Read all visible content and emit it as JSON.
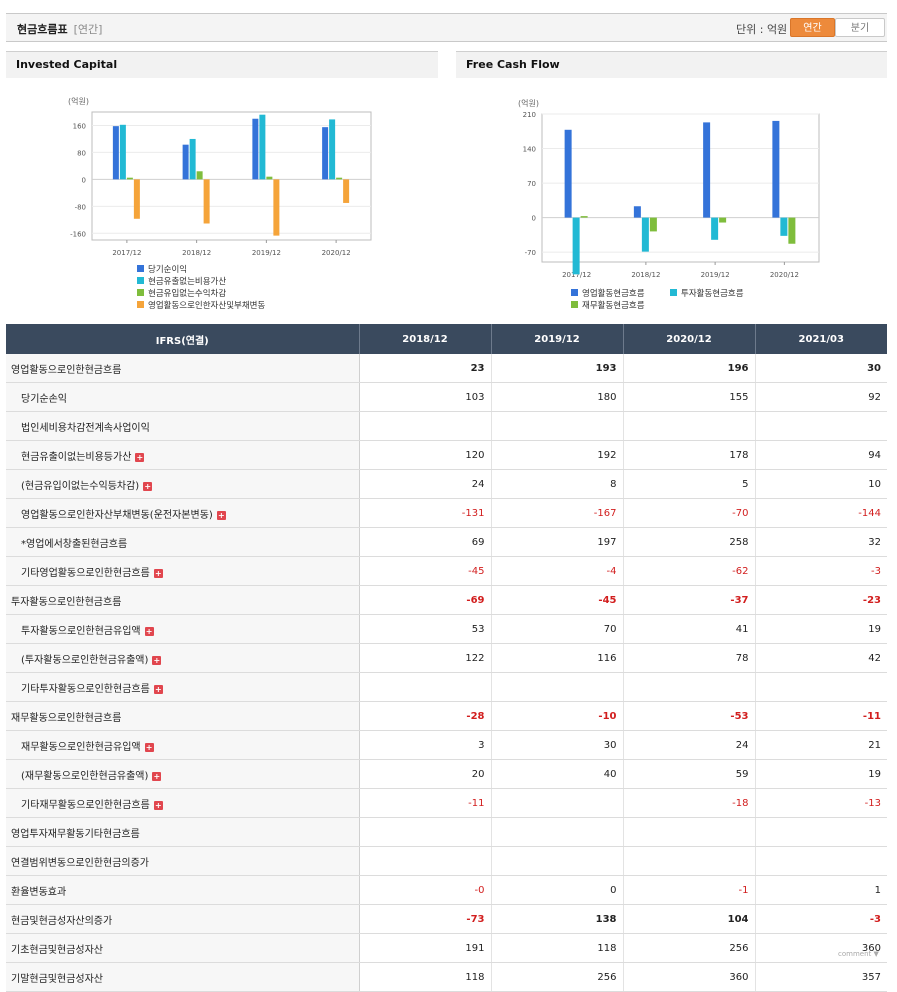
{
  "header": {
    "title": "현금흐름표",
    "subtitle": "[연간]",
    "unit_label": "단위 : 억원",
    "annual_button": "연간",
    "quarter_button": "분기"
  },
  "panels": {
    "invested_capital_title": "Invested Capital",
    "fcf_title": "Free Cash Flow"
  },
  "chart_data": [
    {
      "type": "bar",
      "ylabel": "(억원)",
      "categories": [
        "2017/12",
        "2018/12",
        "2019/12",
        "2020/12"
      ],
      "ylim": [
        -180,
        200
      ],
      "yticks": [
        160,
        80,
        0,
        -80,
        -160
      ],
      "series": [
        {
          "name": "당기순이익",
          "color": "#3473d9",
          "values": [
            158,
            103,
            180,
            155
          ]
        },
        {
          "name": "현금유출없는비용가산",
          "color": "#22b9d4",
          "values": [
            162,
            120,
            192,
            178
          ]
        },
        {
          "name": "현금유입없는수익차감",
          "color": "#7fbd3c",
          "values": [
            5,
            24,
            8,
            5
          ]
        },
        {
          "name": "영업활동으로인한자산및부채변동",
          "color": "#f5a43a",
          "values": [
            -117,
            -131,
            -167,
            -70
          ]
        }
      ],
      "legend": "bottom-left",
      "grid": true
    },
    {
      "type": "bar",
      "ylabel": "(억원)",
      "categories": [
        "2017/12",
        "2018/12",
        "2019/12",
        "2020/12"
      ],
      "ylim": [
        -90,
        210
      ],
      "yticks": [
        210,
        140,
        70,
        0,
        -70
      ],
      "series": [
        {
          "name": "영업활동현금흐름",
          "color": "#3473d9",
          "values": [
            178,
            23,
            193,
            196
          ]
        },
        {
          "name": "투자활동현금흐름",
          "color": "#22b9d4",
          "values": [
            -115,
            -69,
            -45,
            -37
          ]
        },
        {
          "name": "재무활동현금흐름",
          "color": "#7fbd3c",
          "values": [
            3,
            -28,
            -10,
            -53
          ]
        }
      ],
      "legend": "bottom-center",
      "grid": true
    }
  ],
  "table": {
    "header_label": "IFRS(연결)",
    "columns": [
      "2018/12",
      "2019/12",
      "2020/12",
      "2021/03"
    ],
    "rows": [
      {
        "label": "영업활동으로인한현금흐름",
        "indent": false,
        "bold": true,
        "plus": false,
        "values": [
          "23",
          "193",
          "196",
          "30"
        ]
      },
      {
        "label": "당기순손익",
        "indent": true,
        "bold": false,
        "plus": false,
        "values": [
          "103",
          "180",
          "155",
          "92"
        ]
      },
      {
        "label": "법인세비용차감전계속사업이익",
        "indent": true,
        "bold": false,
        "plus": false,
        "values": [
          "",
          "",
          "",
          ""
        ]
      },
      {
        "label": "현금유출이없는비용등가산",
        "indent": true,
        "bold": false,
        "plus": true,
        "values": [
          "120",
          "192",
          "178",
          "94"
        ]
      },
      {
        "label": "(현금유입이없는수익등차감)",
        "indent": true,
        "bold": false,
        "plus": true,
        "values": [
          "24",
          "8",
          "5",
          "10"
        ]
      },
      {
        "label": "영업활동으로인한자산부채변동(운전자본변동)",
        "indent": true,
        "bold": false,
        "plus": true,
        "values": [
          "-131",
          "-167",
          "-70",
          "-144"
        ]
      },
      {
        "label": "*영업에서창출된현금흐름",
        "indent": true,
        "bold": false,
        "plus": false,
        "values": [
          "69",
          "197",
          "258",
          "32"
        ]
      },
      {
        "label": "기타영업활동으로인한현금흐름",
        "indent": true,
        "bold": false,
        "plus": true,
        "values": [
          "-45",
          "-4",
          "-62",
          "-3"
        ]
      },
      {
        "label": "투자활동으로인한현금흐름",
        "indent": false,
        "bold": true,
        "plus": false,
        "values": [
          "-69",
          "-45",
          "-37",
          "-23"
        ]
      },
      {
        "label": "투자활동으로인한현금유입액",
        "indent": true,
        "bold": false,
        "plus": true,
        "values": [
          "53",
          "70",
          "41",
          "19"
        ]
      },
      {
        "label": "(투자활동으로인한현금유출액)",
        "indent": true,
        "bold": false,
        "plus": true,
        "values": [
          "122",
          "116",
          "78",
          "42"
        ]
      },
      {
        "label": "기타투자활동으로인한현금흐름",
        "indent": true,
        "bold": false,
        "plus": true,
        "values": [
          "",
          "",
          "",
          ""
        ]
      },
      {
        "label": "재무활동으로인한현금흐름",
        "indent": false,
        "bold": true,
        "plus": false,
        "values": [
          "-28",
          "-10",
          "-53",
          "-11"
        ]
      },
      {
        "label": "재무활동으로인한현금유입액",
        "indent": true,
        "bold": false,
        "plus": true,
        "values": [
          "3",
          "30",
          "24",
          "21"
        ]
      },
      {
        "label": "(재무활동으로인한현금유출액)",
        "indent": true,
        "bold": false,
        "plus": true,
        "values": [
          "20",
          "40",
          "59",
          "19"
        ]
      },
      {
        "label": "기타재무활동으로인한현금흐름",
        "indent": true,
        "bold": false,
        "plus": true,
        "values": [
          "-11",
          "",
          "-18",
          "-13"
        ]
      },
      {
        "label": "영업투자재무활동기타현금흐름",
        "indent": false,
        "bold": false,
        "plus": false,
        "values": [
          "",
          "",
          "",
          ""
        ]
      },
      {
        "label": "연결범위변동으로인한현금의증가",
        "indent": false,
        "bold": false,
        "plus": false,
        "values": [
          "",
          "",
          "",
          ""
        ]
      },
      {
        "label": "환율변동효과",
        "indent": false,
        "bold": false,
        "plus": false,
        "values": [
          "-0",
          "0",
          "-1",
          "1"
        ]
      },
      {
        "label": "현금및현금성자산의증가",
        "indent": false,
        "bold": true,
        "plus": false,
        "values": [
          "-73",
          "138",
          "104",
          "-3"
        ]
      },
      {
        "label": "기초현금및현금성자산",
        "indent": false,
        "bold": false,
        "plus": false,
        "values": [
          "191",
          "118",
          "256",
          "360"
        ]
      },
      {
        "label": "기말현금및현금성자산",
        "indent": false,
        "bold": false,
        "plus": false,
        "values": [
          "118",
          "256",
          "360",
          "357"
        ]
      }
    ]
  },
  "footer": {
    "comment": "comment ▼"
  }
}
